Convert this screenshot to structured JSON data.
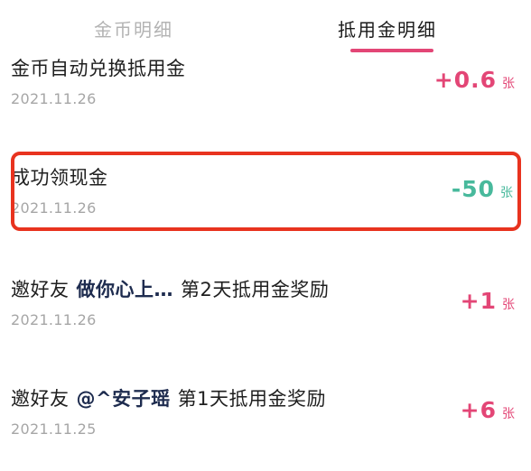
{
  "tabs": {
    "coins": "金币明细",
    "voucher": "抵用金明细"
  },
  "records": [
    {
      "title": "金币自动兑换抵用金",
      "date": "2021.11.26",
      "amount": "+0.6",
      "unit": "张"
    },
    {
      "title": "成功领现金",
      "date": "2021.11.26",
      "amount": "-50",
      "unit": "张"
    },
    {
      "title_prefix": "邀好友",
      "nickname": "做你心上…",
      "title_suffix": "第2天抵用金奖励",
      "date": "2021.11.26",
      "amount": "+1",
      "unit": "张"
    },
    {
      "title_prefix": "邀好友",
      "nickname": "@^安子瑶",
      "title_suffix": "第1天抵用金奖励",
      "date": "2021.11.25",
      "amount": "+6",
      "unit": "张"
    }
  ],
  "colors": {
    "accent": "#e34676",
    "negative": "#48b99c",
    "highlight_box": "#e8331f"
  }
}
